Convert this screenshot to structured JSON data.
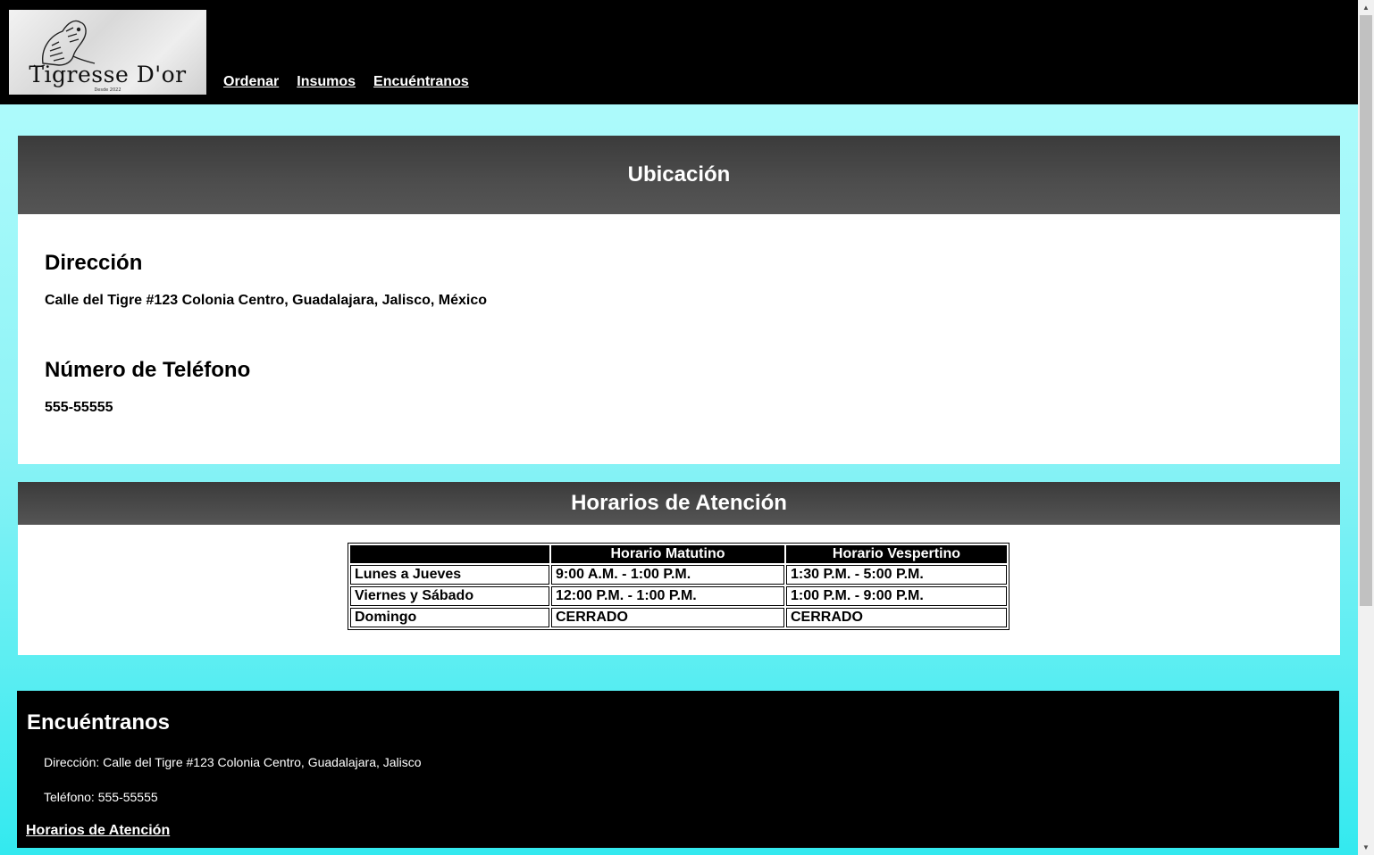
{
  "header": {
    "logo": {
      "name": "Tigresse D'or",
      "subtitle": "Desde 2022"
    },
    "nav": [
      "Ordenar",
      "Insumos",
      "Encuéntranos"
    ]
  },
  "ubicacion": {
    "title": "Ubicación",
    "direccion_heading": "Dirección",
    "direccion": "Calle del Tigre #123 Colonia Centro, Guadalajara, Jalisco, México",
    "telefono_heading": "Número de Teléfono",
    "telefono": "555-55555"
  },
  "horarios": {
    "title": "Horarios de Atención",
    "columns": [
      "",
      "Horario Matutino",
      "Horario Vespertino"
    ],
    "rows": [
      [
        "Lunes a Jueves",
        "9:00 A.M. - 1:00 P.M.",
        "1:30 P.M. - 5:00 P.M."
      ],
      [
        "Viernes y Sábado",
        "12:00 P.M. - 1:00 P.M.",
        "1:00 P.M. - 9:00 P.M."
      ],
      [
        "Domingo",
        "CERRADO",
        "CERRADO"
      ]
    ]
  },
  "footer": {
    "title": "Encuéntranos",
    "direccion": "Dirección: Calle del Tigre #123 Colonia Centro, Guadalajara, Jalisco",
    "telefono": "Teléfono: 555-55555",
    "horarios_link": "Horarios de Atención"
  },
  "scrollbar": {
    "up_icon": "scroll-up-arrow-icon",
    "down_icon": "scroll-down-arrow-icon"
  }
}
